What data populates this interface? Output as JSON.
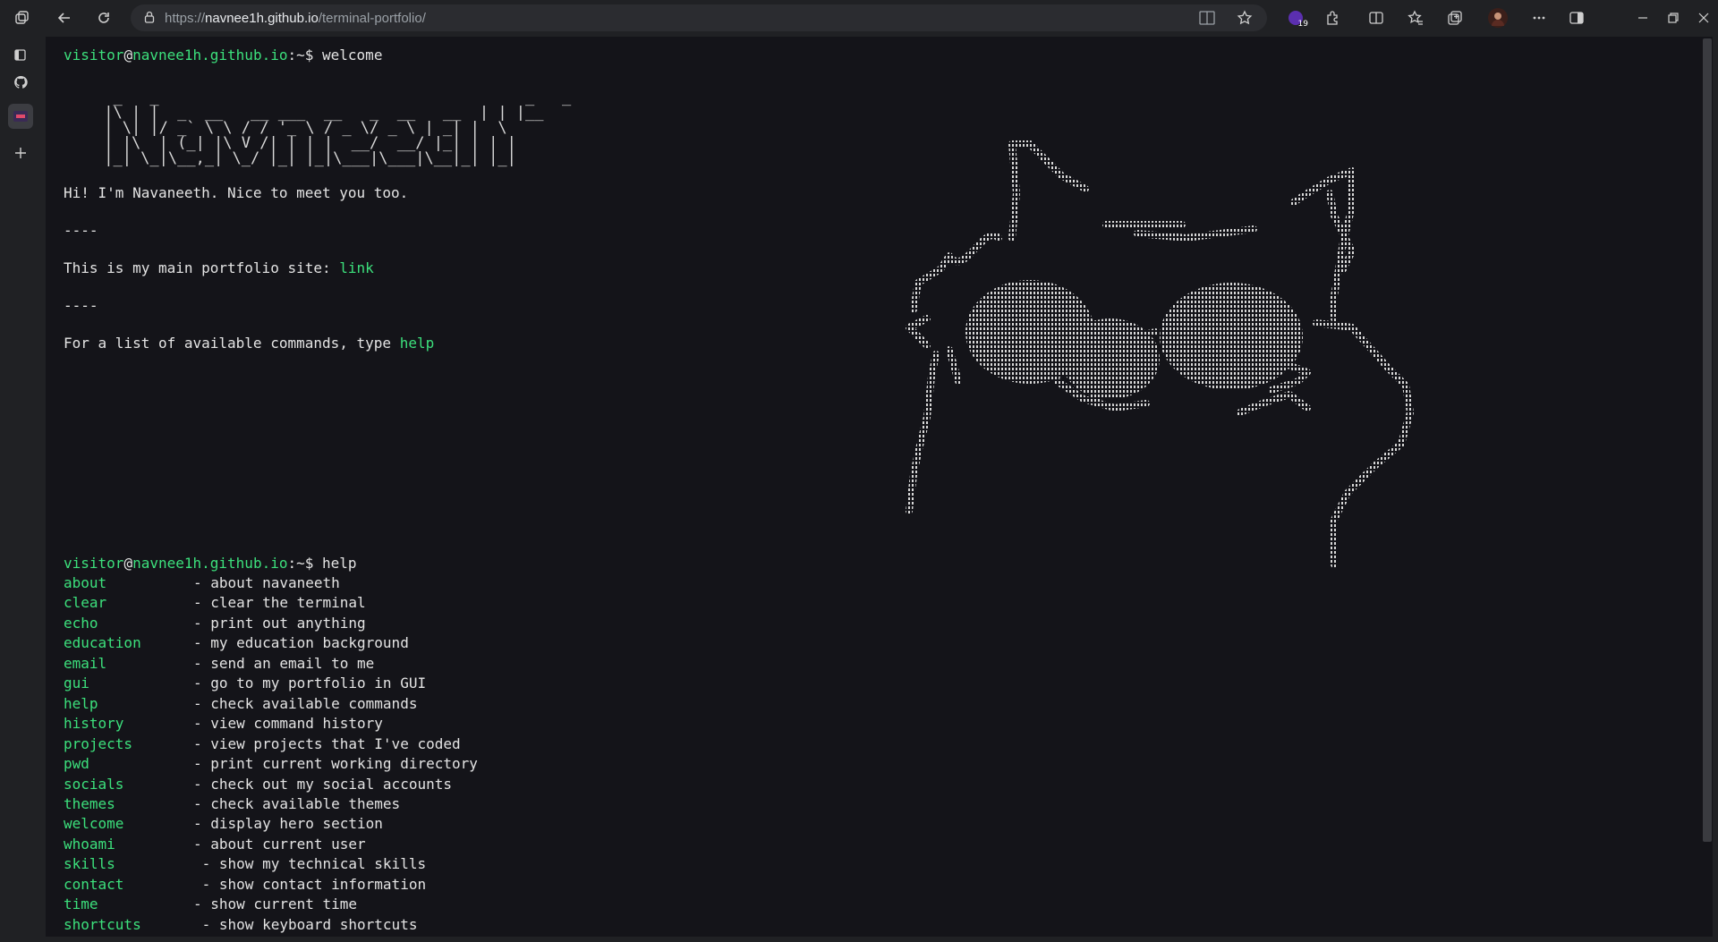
{
  "browser": {
    "url_prefix": "https://",
    "url_host": "navnee1h.github.io",
    "url_path": "/terminal-portfolio/",
    "extension_badge": "19"
  },
  "terminal": {
    "prompt": {
      "user": "visitor",
      "at": "@",
      "host": "navnee1h.github.io",
      "suffix": ":~$"
    },
    "welcome_cmd": "welcome",
    "ascii_title": "  _   _                                        _   _     \n |\\ | |  _  __   __ ___  __   _  __   __  | | |__  \n | \\| |/ _` \\ \\ / / '_ \\ / _ \\/ _ \\ | _| |  \\ \n | |\\  | (_| |\\ V /| | | |  __/  __/ |_| | | |\n |_| \\_|\\__,_| \\_/ |_| |_|\\___|\\___|\\__|_| |_|",
    "greeting": "Hi! I'm Navaneeth. Nice to meet you too.",
    "separator": "----",
    "portfolio_text": "This is my main portfolio site: ",
    "portfolio_link": "link",
    "commands_text": "For a list of available commands, type ",
    "help_link": "help",
    "help_cmd": "help",
    "commands": [
      {
        "name": "about",
        "desc": "- about navaneeth"
      },
      {
        "name": "clear",
        "desc": "- clear the terminal"
      },
      {
        "name": "echo",
        "desc": "- print out anything"
      },
      {
        "name": "education",
        "desc": "- my education background"
      },
      {
        "name": "email",
        "desc": "- send an email to me"
      },
      {
        "name": "gui",
        "desc": "- go to my portfolio in GUI"
      },
      {
        "name": "help",
        "desc": "- check available commands"
      },
      {
        "name": "history",
        "desc": "- view command history"
      },
      {
        "name": "projects",
        "desc": "- view projects that I've coded"
      },
      {
        "name": "pwd",
        "desc": "- print current working directory"
      },
      {
        "name": "socials",
        "desc": "- check out my social accounts"
      },
      {
        "name": "themes",
        "desc": "- check available themes"
      },
      {
        "name": "welcome",
        "desc": "- display hero section"
      },
      {
        "name": "whoami",
        "desc": "- about current user"
      },
      {
        "name": "skills",
        "desc": " - show my technical skills"
      },
      {
        "name": "contact",
        "desc": " - show contact information"
      },
      {
        "name": "time",
        "desc": "- show current time"
      },
      {
        "name": "shortcuts",
        "desc": " - show keyboard shortcuts"
      }
    ]
  },
  "colors": {
    "accent_green": "#3ce07c",
    "terminal_bg": "#141419",
    "text": "#e4e4e4"
  },
  "icons": [
    "workspaces-icon",
    "back-icon",
    "refresh-icon",
    "lock-icon",
    "reader-mode-icon",
    "star-icon",
    "extension-icon",
    "split-screen-icon",
    "favorites-icon",
    "collections-icon",
    "profile-avatar",
    "more-icon",
    "sidebar-toggle-icon",
    "minimize-icon",
    "restore-icon",
    "close-icon",
    "tabs-icon",
    "github-icon",
    "plus-icon"
  ]
}
